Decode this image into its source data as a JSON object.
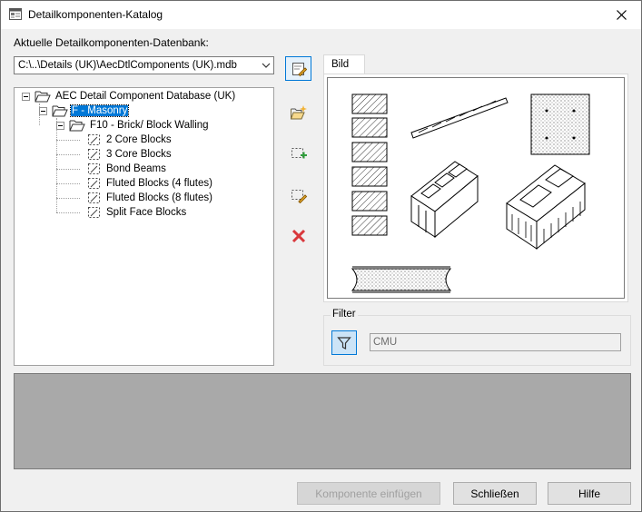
{
  "window": {
    "title": "Detailkomponenten-Katalog"
  },
  "database": {
    "label": "Aktuelle Detailkomponenten-Datenbank:",
    "selected": "C:\\..\\Details (UK)\\AecDtlComponents (UK).mdb"
  },
  "tree": {
    "root": "AEC Detail Component Database (UK)",
    "category": "F - Masonry",
    "subcategory": "F10 - Brick/ Block Walling",
    "items": [
      "2 Core Blocks",
      "3 Core Blocks",
      "Bond Beams",
      "Fluted Blocks (4 flutes)",
      "Fluted Blocks (8 flutes)",
      "Split Face Blocks"
    ]
  },
  "preview": {
    "tab_label": "Bild"
  },
  "filter": {
    "group_label": "Filter",
    "value": "CMU"
  },
  "buttons": {
    "insert": "Komponente einfügen",
    "close": "Schließen",
    "help": "Hilfe"
  }
}
